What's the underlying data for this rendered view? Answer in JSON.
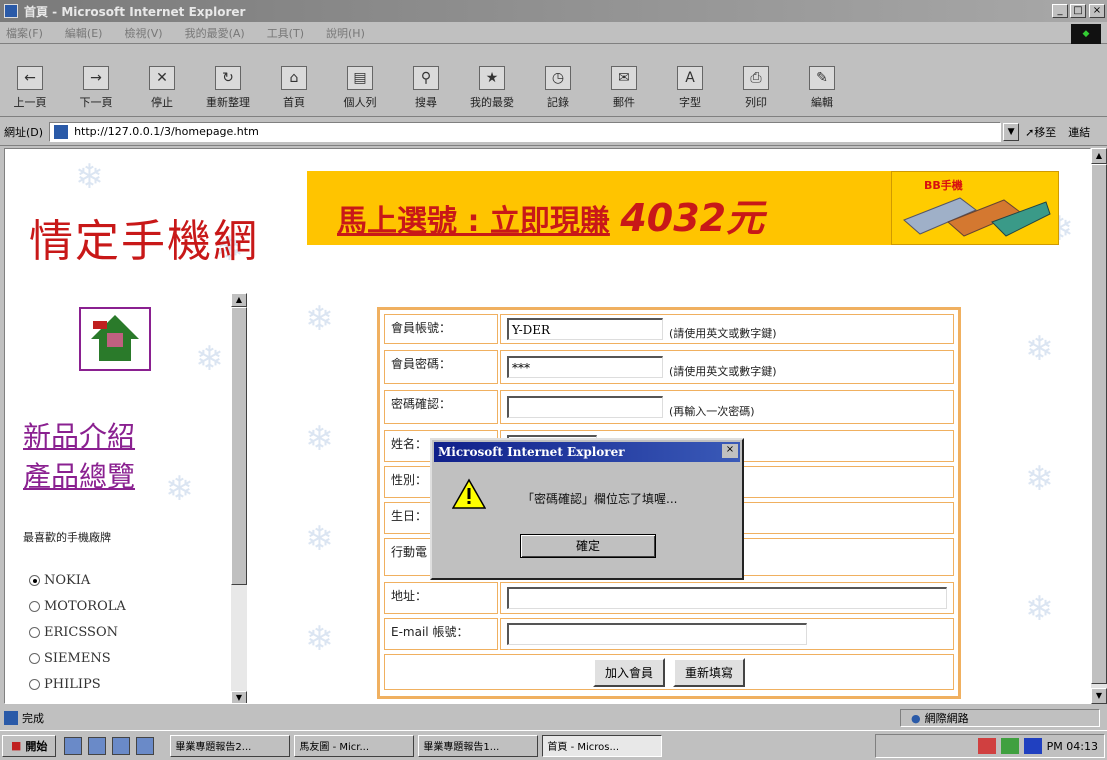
{
  "window": {
    "title": "首頁 - Microsoft Internet Explorer",
    "controls": [
      "_",
      "□",
      "×"
    ]
  },
  "menu": [
    "檔案(F)",
    "編輯(E)",
    "檢視(V)",
    "我的最愛(A)",
    "工具(T)",
    "說明(H)"
  ],
  "toolbar": [
    "上一頁",
    "下一頁",
    "停止",
    "重新整理",
    "首頁",
    "個人列",
    "搜尋",
    "我的最愛",
    "記錄",
    "郵件",
    "字型",
    "列印",
    "編輯"
  ],
  "address": {
    "label": "網址(D)",
    "url": "http://127.0.0.1/3/homepage.htm",
    "go": "移至",
    "links": "連結"
  },
  "page": {
    "site_title": "情定手機網",
    "banner_text": "馬上選號 : 立即現賺",
    "banner_amount": "4032元",
    "promo_label": "BB手機",
    "nav_new": "新品介紹",
    "nav_catalog": "產品總覽",
    "brands_heading": "最喜歡的手機廠牌",
    "brands": [
      {
        "label": "NOKIA",
        "selected": true
      },
      {
        "label": "MOTOROLA",
        "selected": false
      },
      {
        "label": "ERICSSON",
        "selected": false
      },
      {
        "label": "SIEMENS",
        "selected": false
      },
      {
        "label": "PHILIPS",
        "selected": false
      }
    ]
  },
  "form": {
    "account_label": "會員帳號：",
    "account_value": "Y-DER",
    "account_hint": "(請使用英文或數字鍵)",
    "password_label": "會員密碼：",
    "password_value": "***",
    "password_hint": "(請使用英文或數字鍵)",
    "confirm_label": "密碼確認：",
    "confirm_value": "",
    "confirm_hint": "(再輸入一次密碼)",
    "name_label": "姓名：",
    "gender_label": "性別：",
    "birthday_label": "生日：",
    "mobile_label": "行動電",
    "address_label": "地址：",
    "email_label": "E-mail 帳號：",
    "join_button": "加入會員",
    "reset_button": "重新填寫"
  },
  "dialog": {
    "title": "Microsoft Internet Explorer",
    "message": "「密碼確認」欄位忘了填喔...",
    "ok": "確定"
  },
  "status": {
    "text": "完成",
    "zone": "網際網路"
  },
  "taskbar": {
    "start": "開始",
    "tasks": [
      "畢業專題報告2...",
      "馬友圖 - Micr...",
      "畢業專題報告1...",
      "首頁 - Micros..."
    ],
    "clock": "PM 04:13"
  },
  "colors": {
    "site_title": "#c81818",
    "banner_bg": "#ffc400",
    "nav_link": "#8a2090",
    "form_border": "#f0b060",
    "dialog_title": "#10208a"
  }
}
